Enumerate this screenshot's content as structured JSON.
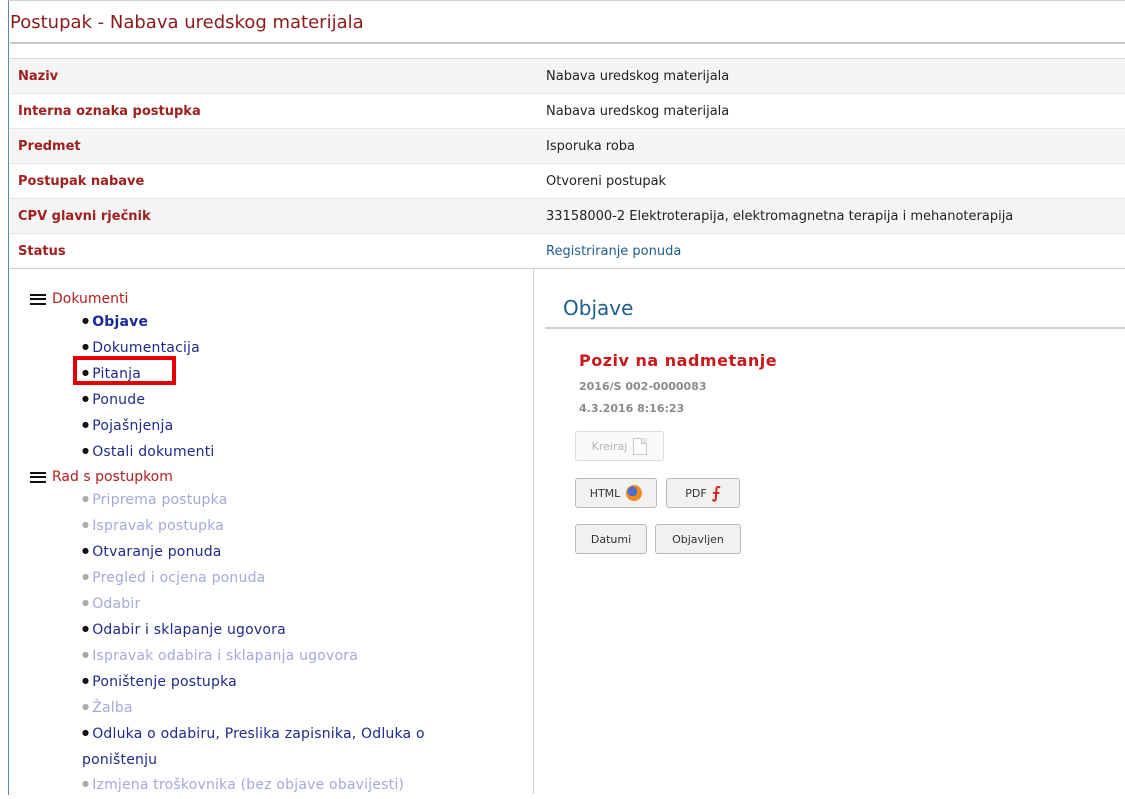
{
  "page": {
    "title": "Postupak - Nabava uredskog materijala"
  },
  "info": [
    {
      "label": "Naziv",
      "value": "Nabava uredskog materijala"
    },
    {
      "label": "Interna oznaka postupka",
      "value": "Nabava uredskog materijala"
    },
    {
      "label": "Predmet",
      "value": "Isporuka roba"
    },
    {
      "label": "Postupak nabave",
      "value": "Otvoreni postupak"
    },
    {
      "label": "CPV glavni rječnik",
      "value": "33158000-2 Elektroterapija, elektromagnetna terapija i mehanoterapija"
    },
    {
      "label": "Status",
      "value": "Registriranje ponuda"
    }
  ],
  "nav": {
    "documents": {
      "header": "Dokumenti",
      "items": [
        "Objave",
        "Dokumentacija",
        "Pitanja",
        "Ponude",
        "Pojašnjenja",
        "Ostali dokumenti"
      ]
    },
    "procedure": {
      "header": "Rad s postupkom",
      "items": [
        "Priprema postupka",
        "Ispravak postupka",
        "Otvaranje ponuda",
        "Pregled i ocjena ponuda",
        "Odabir",
        "Odabir i sklapanje ugovora",
        "Ispravak odabira i sklapanja ugovora",
        "Poništenje postupka",
        "Žalba",
        "Odluka o odabiru, Preslika zapisnika, Odluka o poništenju",
        "Izmjena troškovnika (bez objave obavijesti)"
      ]
    }
  },
  "main": {
    "heading": "Objave",
    "notice": {
      "title": "Poziv na nadmetanje",
      "number": "2016/S 002-0000083",
      "date": "4.3.2016 8:16:23"
    },
    "buttons": {
      "kreiraj": "Kreiraj",
      "html": "HTML",
      "pdf": "PDF",
      "datumi": "Datumi",
      "objavljen": "Objavljen"
    }
  },
  "colors": {
    "label_red": "#a02020",
    "link_blue": "#1f5f8b",
    "highlight": "#e40000"
  }
}
